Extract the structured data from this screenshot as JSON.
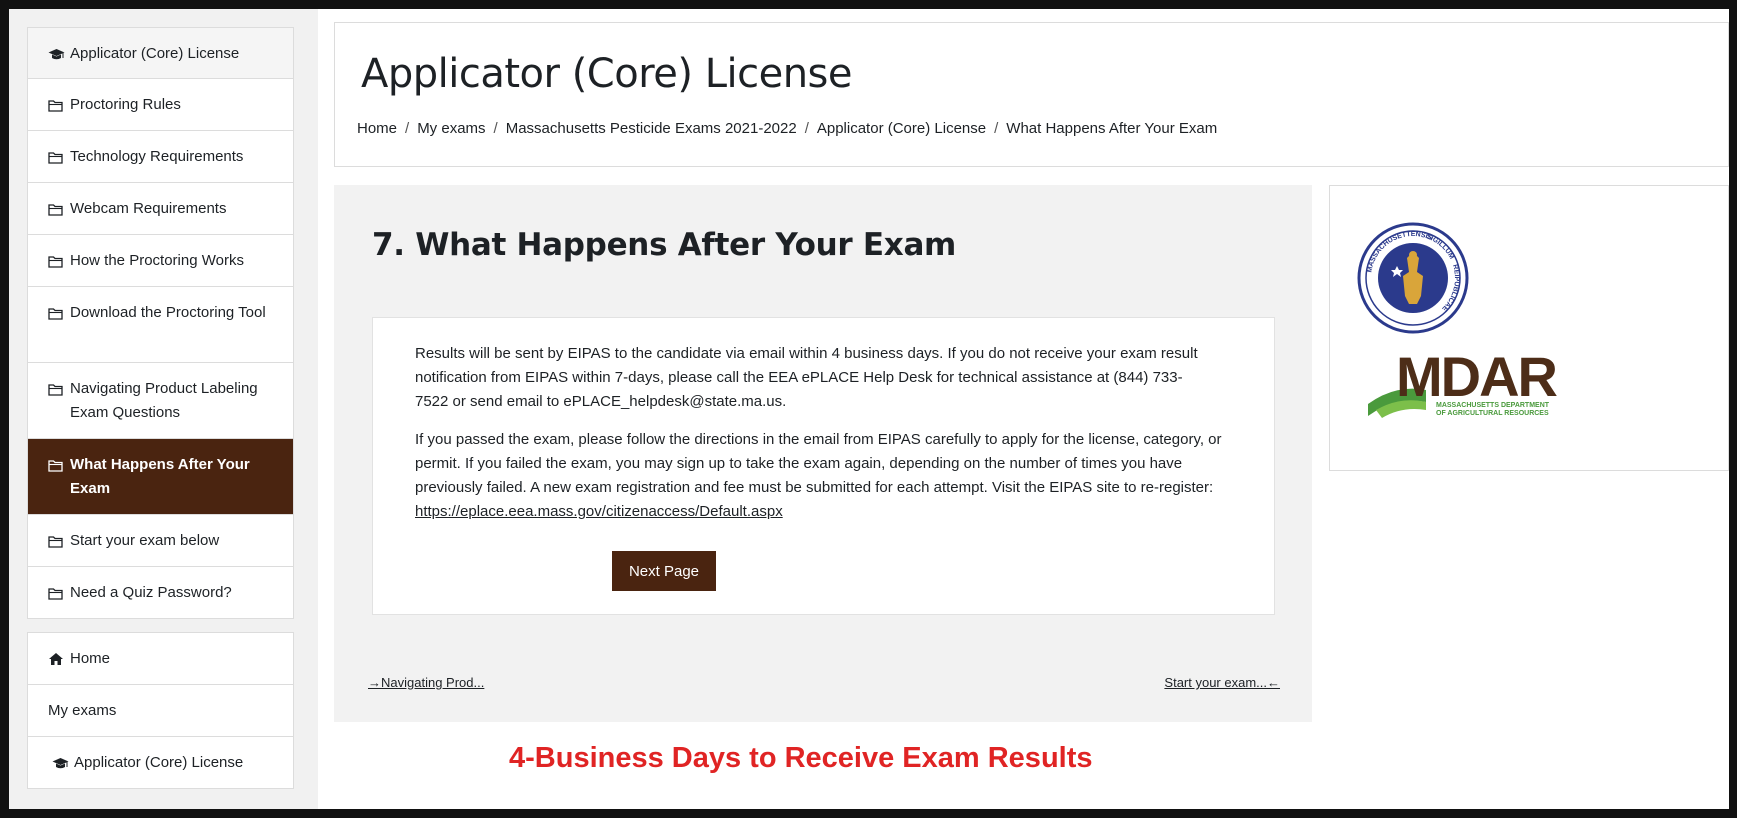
{
  "sidebar": {
    "course_items": [
      {
        "label": "Applicator (Core) License",
        "icon": "graduation-cap-icon"
      },
      {
        "label": "Proctoring Rules",
        "icon": "folder-icon"
      },
      {
        "label": "Technology Requirements",
        "icon": "folder-icon"
      },
      {
        "label": "Webcam Requirements",
        "icon": "folder-icon"
      },
      {
        "label": "How the Proctoring Works",
        "icon": "folder-icon"
      },
      {
        "label": "Download the Proctoring Tool",
        "icon": "folder-icon"
      },
      {
        "label": "Navigating Product Labeling Exam Questions",
        "icon": "folder-icon"
      },
      {
        "label": "What Happens After Your Exam",
        "icon": "folder-icon",
        "active": true
      },
      {
        "label": "Start your exam below",
        "icon": "folder-icon"
      },
      {
        "label": "Need a Quiz Password?",
        "icon": "folder-icon"
      }
    ],
    "site_items": [
      {
        "label": "Home",
        "icon": "home-icon"
      },
      {
        "label": "My exams",
        "icon": ""
      },
      {
        "label": "Applicator (Core) License",
        "icon": "graduation-cap-icon"
      }
    ]
  },
  "header": {
    "title": "Applicator (Core) License",
    "breadcrumb": [
      "Home",
      "My exams",
      "Massachusetts Pesticide Exams 2021-2022",
      "Applicator (Core) License",
      "What Happens After Your Exam"
    ]
  },
  "main": {
    "section_title": "7. What Happens After Your Exam",
    "para1": "Results will be sent by EIPAS to the candidate via email within 4 business days. If you do not receive your exam result notification from EIPAS within 7-days, please call the EEA ePLACE Help Desk for technical assistance at (844) 733-7522 or send email to ePLACE_helpdesk@state.ma.us.",
    "para2": "If you passed the exam, please follow the directions in the email from EIPAS carefully to apply for the license, category, or permit. If you failed the exam, you may sign up to take the exam again, depending on the number of times you have previously failed. A new exam registration and fee must be submitted for each attempt. Visit the EIPAS site to re-register: ",
    "link": "https://eplace.eea.mass.gov/citizenaccess/Default.aspx",
    "next_button": "Next Page",
    "prev_nav": "→Navigating Prod...",
    "next_nav": "Start your exam...←"
  },
  "logos": {
    "mdar_text": "MDAR",
    "mdar_sub1": "MASSACHUSETTS DEPARTMENT",
    "mdar_sub2": "OF AGRICULTURAL RESOURCES",
    "seal_text_top": "SIGILLUM",
    "seal_text_left": "MASSACHUSETTENSIS",
    "seal_text_right": "REIPUBLICAE"
  },
  "caption": "4-Business Days to Receive Exam Results",
  "colors": {
    "accent": "#4a2410",
    "caption": "#e02424",
    "mdar_brown": "#4d2d18",
    "mdar_green": "#4a9a3c"
  }
}
